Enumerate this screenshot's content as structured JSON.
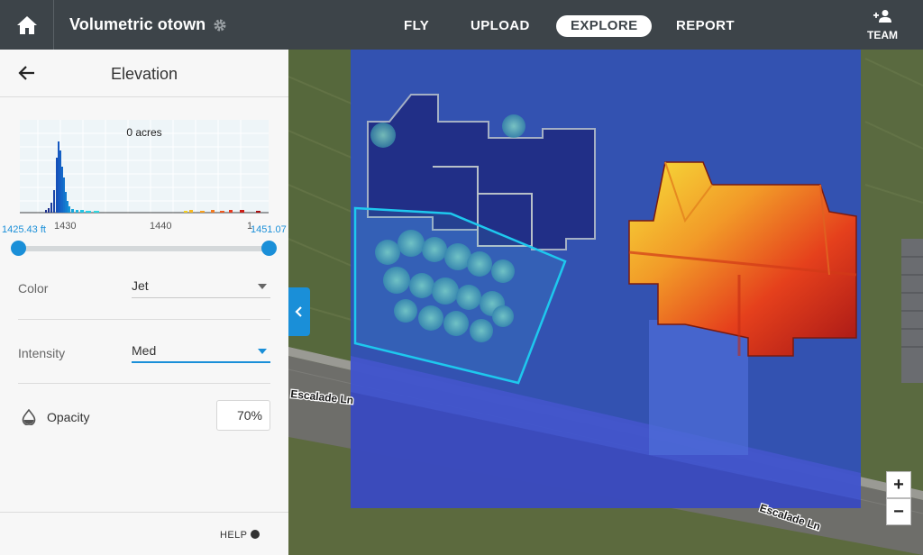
{
  "header": {
    "project_title": "Volumetric otown",
    "tabs": [
      {
        "label": "FLY",
        "active": false
      },
      {
        "label": "UPLOAD",
        "active": false
      },
      {
        "label": "EXPLORE",
        "active": true
      },
      {
        "label": "REPORT",
        "active": false
      }
    ],
    "team_label": "TEAM"
  },
  "panel": {
    "title": "Elevation",
    "histogram": {
      "area_label": "0 acres",
      "tick_labels": [
        "1430",
        "1440",
        "1"
      ],
      "range_min_label": "1425.43 ft",
      "range_max_label": "1451.07"
    },
    "color": {
      "label": "Color",
      "value": "Jet"
    },
    "intensity": {
      "label": "Intensity",
      "value": "Med"
    },
    "opacity": {
      "label": "Opacity",
      "value": "70%"
    },
    "help_label": "HELP"
  },
  "map": {
    "street_labels": [
      "Escalade Ln",
      "Escalade Ln"
    ],
    "zoom_in_label": "+",
    "zoom_out_label": "−"
  },
  "colors": {
    "accent": "#1a8fd8",
    "topbar": "#3d4449",
    "selection_outline": "#1ec8ee"
  }
}
